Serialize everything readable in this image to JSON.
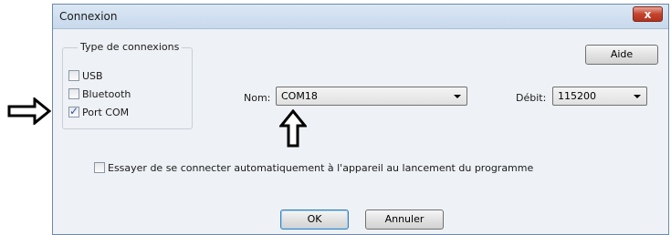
{
  "dialog": {
    "title": "Connexion",
    "close_label": "x",
    "help_label": "Aide",
    "connection_type": {
      "legend": "Type de connexions",
      "options": [
        {
          "label": "USB",
          "checked": false
        },
        {
          "label": "Bluetooth",
          "checked": false
        },
        {
          "label": "Port COM",
          "checked": true
        }
      ]
    },
    "nom": {
      "label": "Nom:",
      "value": "COM18"
    },
    "debit": {
      "label": "Débit:",
      "value": "115200"
    },
    "auto_connect": {
      "label": "Essayer de se connecter automatiquement à l'appareil au lancement du programme",
      "checked": false
    },
    "ok_label": "OK",
    "cancel_label": "Annuler"
  },
  "annotations": {
    "right_arrow_icon": "right-arrow-icon",
    "up_arrow_icon": "up-arrow-icon"
  }
}
